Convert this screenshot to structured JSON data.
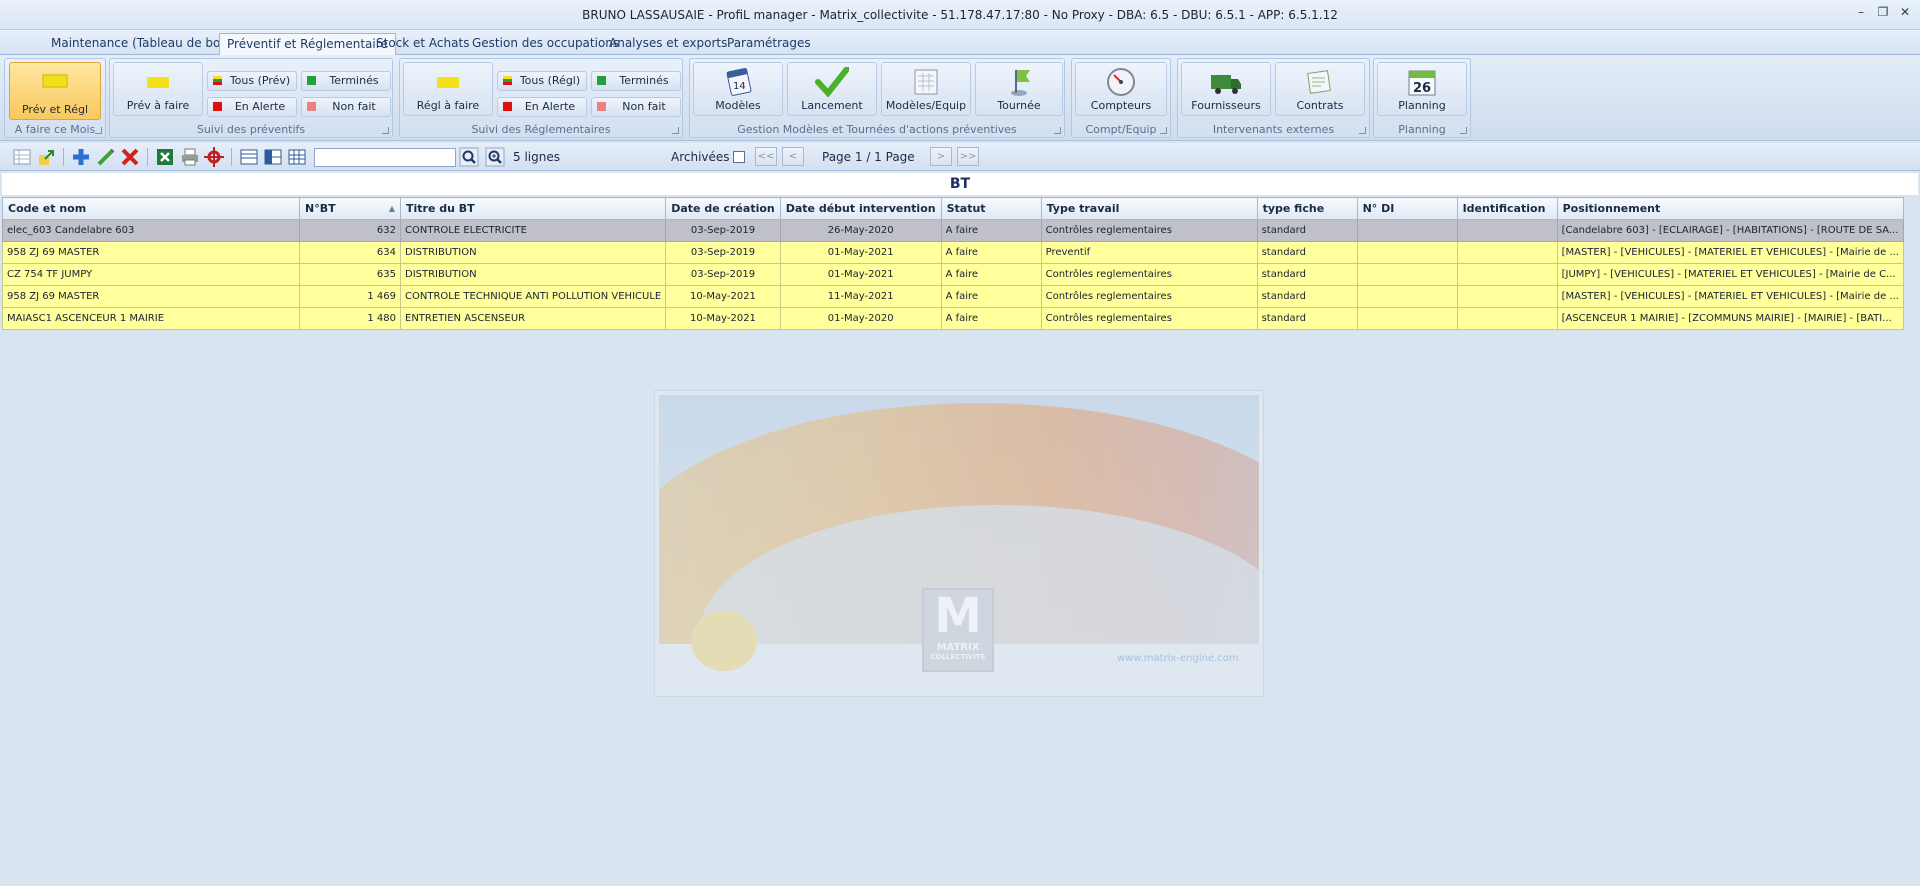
{
  "window": {
    "title": "BRUNO LASSAUSAIE - ProfiL manager - Matrix_collectivite - 51.178.47.17:80 - No Proxy - DBA: 6.5 - DBU: 6.5.1 - APP: 6.5.1.12"
  },
  "menu": {
    "tabs": [
      {
        "label": "Maintenance (Tableau de bord)"
      },
      {
        "label": "Préventif et Réglementaire"
      },
      {
        "label": "Stock et Achats"
      },
      {
        "label": "Gestion des occupations"
      },
      {
        "label": "Analyses et exports"
      },
      {
        "label": "Paramétrages"
      }
    ]
  },
  "ribbon": {
    "g1": {
      "label": "A faire ce Mois",
      "btn": "Prév et Régl"
    },
    "g2": {
      "label": "Suivi des préventifs",
      "btn": "Prév à faire",
      "tous": "Tous (Prév)",
      "alerte": "En Alerte",
      "termines": "Terminés",
      "nonfait": "Non fait"
    },
    "g3": {
      "label": "Suivi des Réglementaires",
      "btn": "Régl à faire",
      "tous": "Tous (Régl)",
      "alerte": "En Alerte",
      "termines": "Terminés",
      "nonfait": "Non fait"
    },
    "g4": {
      "label": "Gestion Modèles et Tournées d'actions préventives",
      "modeles": "Modèles",
      "lancement": "Lancement",
      "modeq": "Modèles/Equip",
      "tournee": "Tournée"
    },
    "g5": {
      "label": "Compt/Equip",
      "btn": "Compteurs"
    },
    "g6": {
      "label": "Intervenants externes",
      "fournisseurs": "Fournisseurs",
      "contrats": "Contrats"
    },
    "g7": {
      "label": "Planning",
      "btn": "Planning",
      "day": "26"
    },
    "colors": {
      "alert": "#e01010",
      "done": "#22a13a",
      "notdone": "#f08080",
      "todo": "#f2e11a"
    }
  },
  "toolbar": {
    "search_value": "",
    "count": "5 lignes",
    "archives": "Archivées",
    "archives_checked": false,
    "first": "<<",
    "prev": "<",
    "page": "Page 1 / 1 Page",
    "next": ">",
    "last": ">>"
  },
  "grid": {
    "title": "BT",
    "columns": [
      "Code et nom",
      "N°BT",
      "Titre du BT",
      "Date de création",
      "Date début intervention",
      "Statut",
      "Type travail",
      "type fiche",
      "N° DI",
      "Identification",
      "Positionnement"
    ],
    "rows": [
      [
        "elec_603  Candelabre 603",
        "632",
        "CONTROLE ELECTRICITE",
        "03-Sep-2019",
        "26-May-2020",
        "A faire",
        "Contrôles reglementaires",
        "standard",
        "",
        "",
        "[Candelabre 603] - [ECLAIRAGE] - [HABITATIONS] - [ROUTE DE SA..."
      ],
      [
        "958 ZJ 69  MASTER",
        "634",
        "DISTRIBUTION",
        "03-Sep-2019",
        "01-May-2021",
        "A faire",
        "Preventif",
        "standard",
        "",
        "",
        "[MASTER] - [VEHICULES] - [MATERIEL ET VEHICULES] - [Mairie de ..."
      ],
      [
        "CZ 754 TF  JUMPY",
        "635",
        "DISTRIBUTION",
        "03-Sep-2019",
        "01-May-2021",
        "A faire",
        "Contrôles reglementaires",
        "standard",
        "",
        "",
        "[JUMPY] - [VEHICULES] - [MATERIEL ET VEHICULES] - [Mairie de C..."
      ],
      [
        "958 ZJ 69  MASTER",
        "1 469",
        "CONTROLE TECHNIQUE ANTI POLLUTION VEHICULE",
        "10-May-2021",
        "11-May-2021",
        "A faire",
        "Contrôles reglementaires",
        "standard",
        "",
        "",
        "[MASTER] - [VEHICULES] - [MATERIEL ET VEHICULES] - [Mairie de ..."
      ],
      [
        "MAIASC1  ASCENCEUR 1 MAIRIE",
        "1 480",
        "ENTRETIEN ASCENSEUR",
        "10-May-2021",
        "01-May-2020",
        "A faire",
        "Contrôles reglementaires",
        "standard",
        "",
        "",
        "[ASCENCEUR 1 MAIRIE] - [ZCOMMUNS MAIRIE] - [MAIRIE] - [BATI..."
      ]
    ]
  },
  "splash": {
    "logo_text": "MATRIX",
    "logo_sub": "COLLECTIVITE",
    "url": "www.matrix-engine.com"
  }
}
